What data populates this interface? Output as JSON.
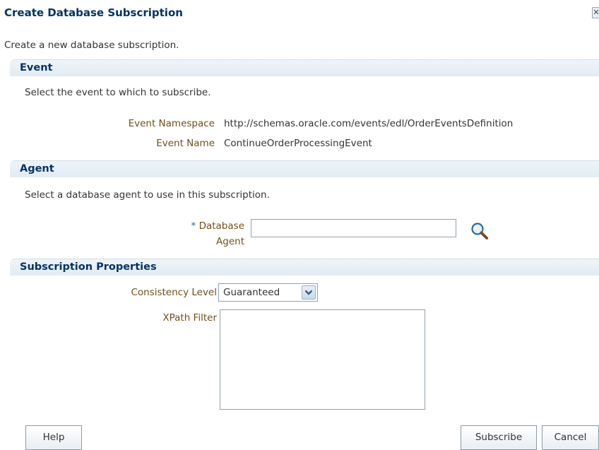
{
  "dialog": {
    "title": "Create Database Subscription",
    "close_icon": "close-icon",
    "intro": "Create a new database subscription."
  },
  "event_section": {
    "header": "Event",
    "description": "Select the event to which to subscribe.",
    "namespace_label": "Event Namespace",
    "namespace_value": "http://schemas.oracle.com/events/edl/OrderEventsDefinition",
    "name_label": "Event Name",
    "name_value": "ContinueOrderProcessingEvent"
  },
  "agent_section": {
    "header": "Agent",
    "description": "Select a database agent to use in this subscription.",
    "required_marker": "*",
    "agent_label_line1": "Database",
    "agent_label_line2": "Agent",
    "agent_value": "",
    "search_icon": "magnifier-search-icon"
  },
  "properties_section": {
    "header": "Subscription Properties",
    "consistency_label": "Consistency Level",
    "consistency_value": "Guaranteed",
    "xpath_label": "XPath Filter",
    "xpath_value": ""
  },
  "buttons": {
    "help": "Help",
    "subscribe": "Subscribe",
    "cancel": "Cancel"
  },
  "colors": {
    "title": "#003366",
    "label": "#6f5016",
    "section_bg": "#e9f0f6"
  }
}
